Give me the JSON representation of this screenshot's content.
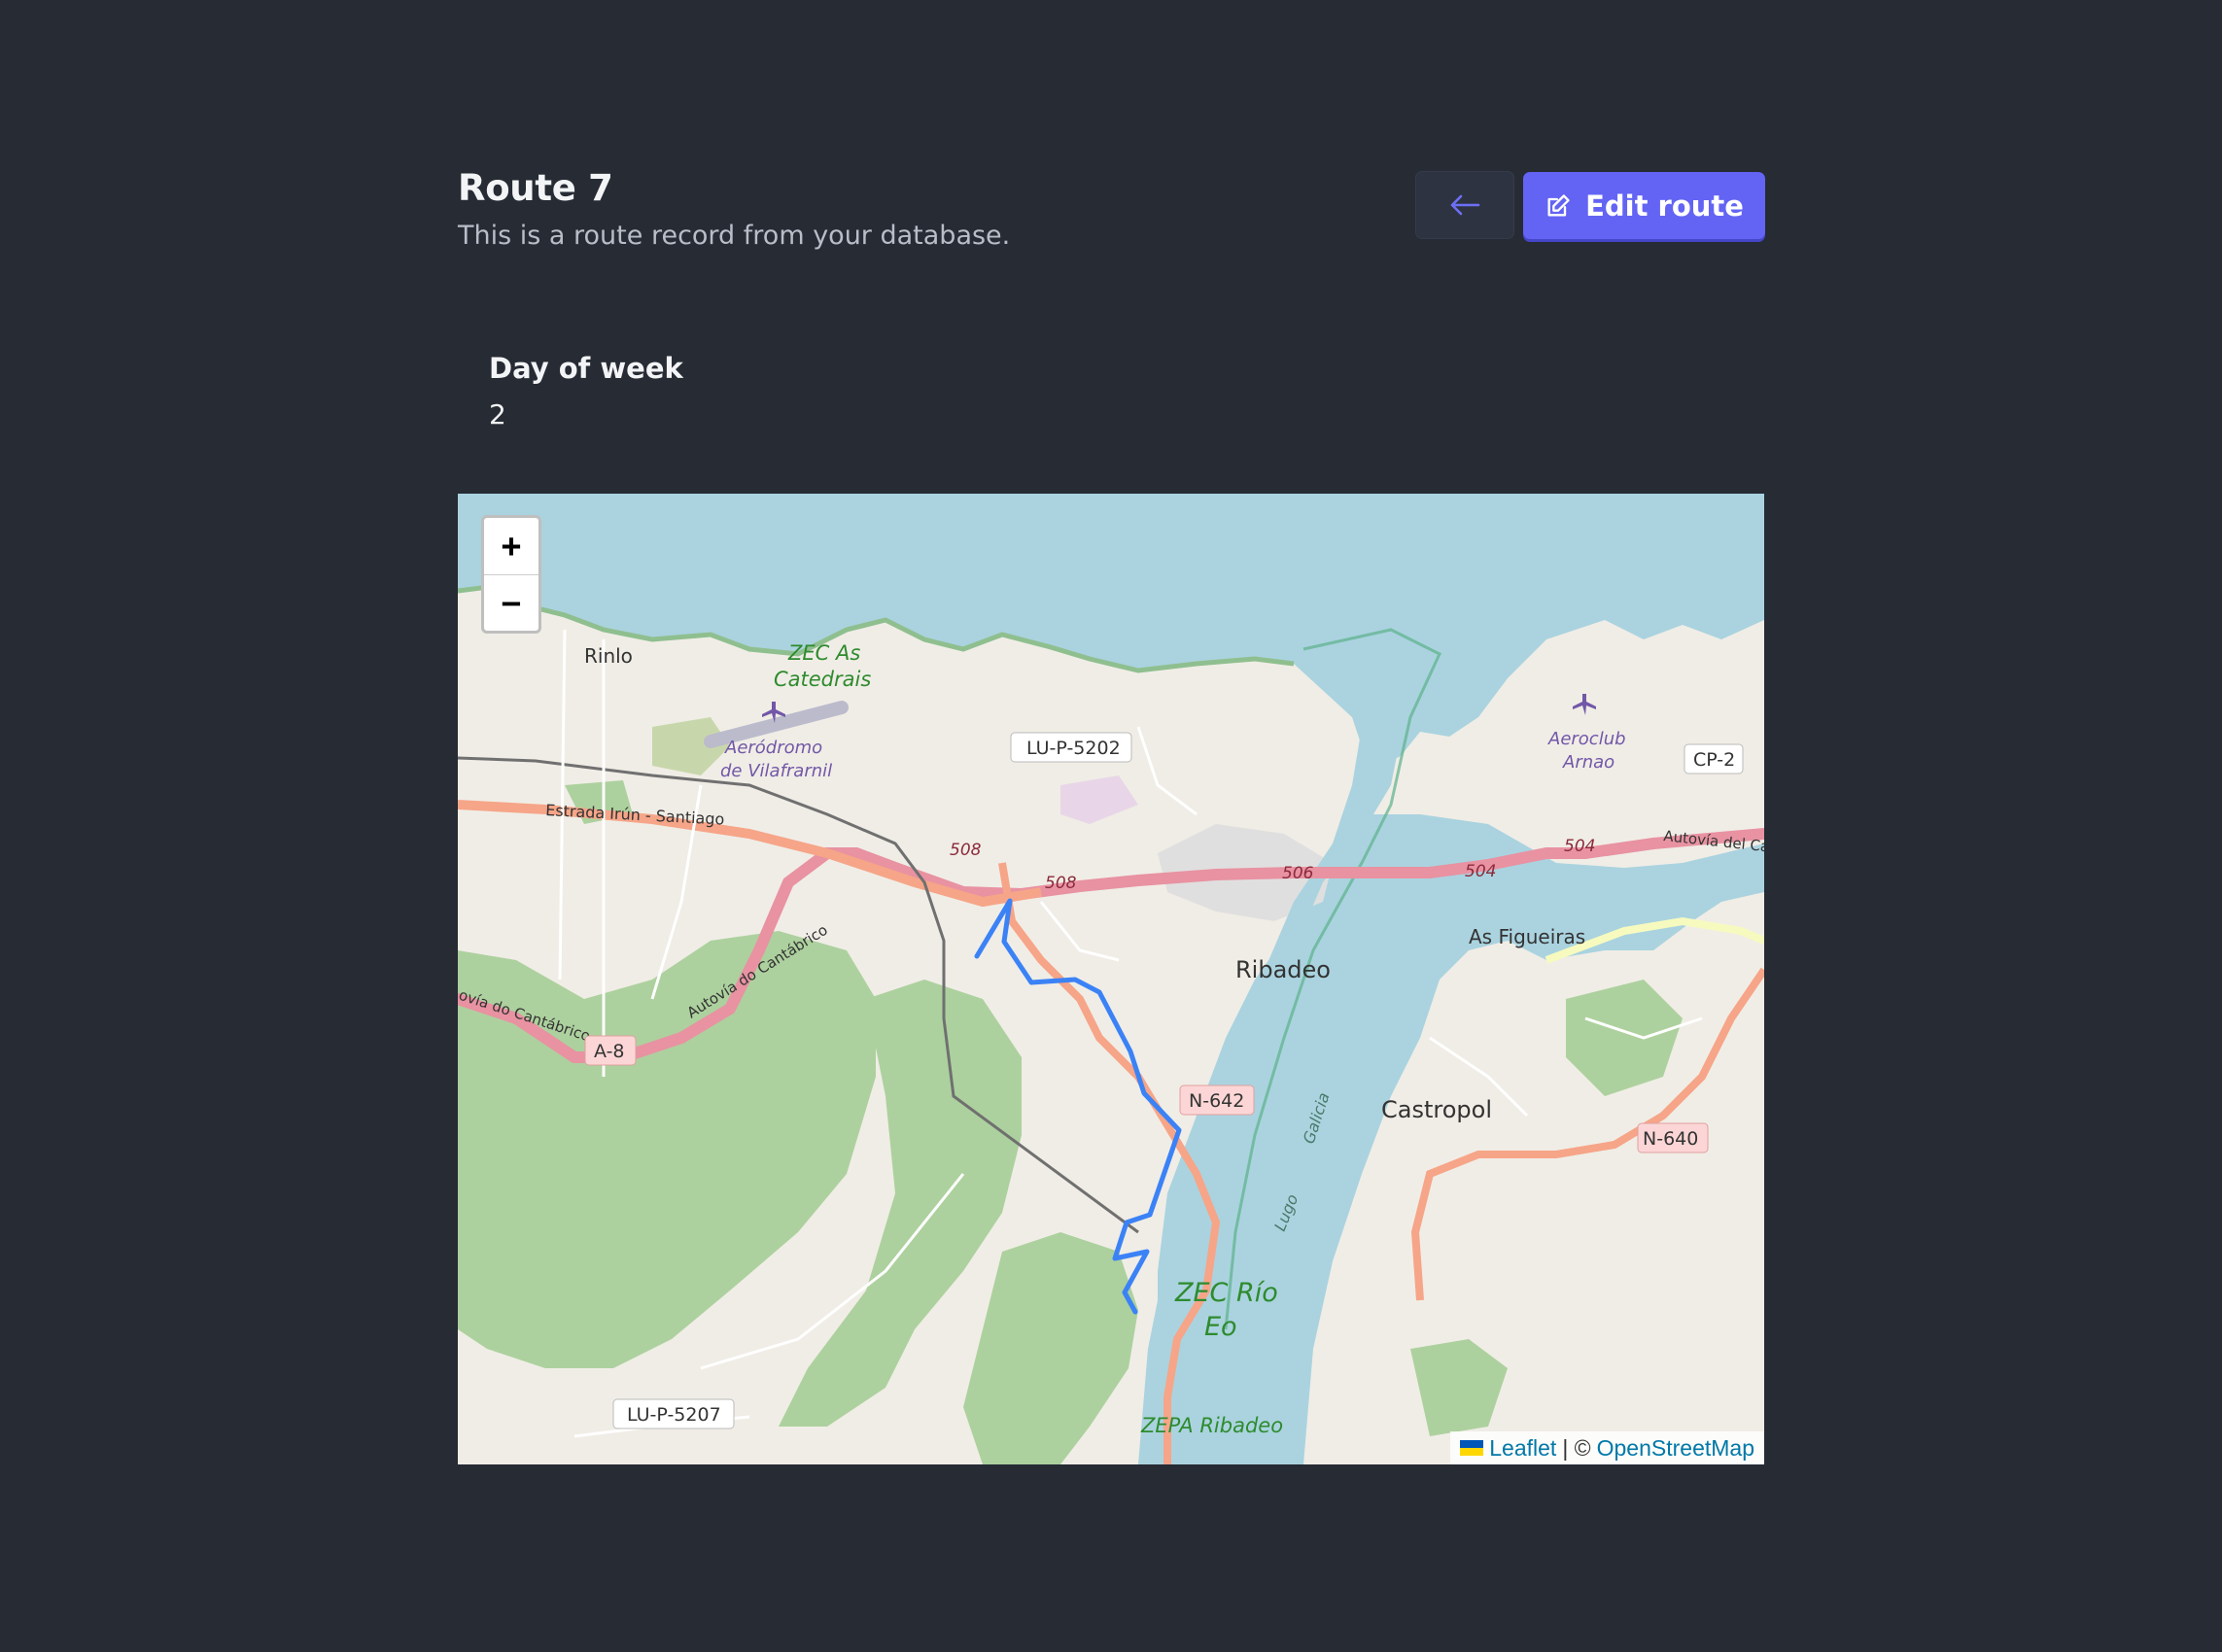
{
  "header": {
    "title": "Route 7",
    "subtitle": "This is a route record from your database.",
    "back_icon": "arrow-left-icon",
    "edit_icon": "pencil-square-icon",
    "edit_label": "Edit route"
  },
  "field": {
    "label": "Day of week",
    "value": "2"
  },
  "map": {
    "zoom_in": "+",
    "zoom_out": "−",
    "attribution": {
      "leaflet": "Leaflet",
      "separator": "| ©",
      "osm": "OpenStreetMap"
    },
    "place_labels": {
      "rinlo": "Rinlo",
      "zec_as_catedrais_1": "ZEC As",
      "zec_as_catedrais_2": "Catedrais",
      "aerodromo_1": "Aeródromo",
      "aerodromo_2": "de Vilafrarnil",
      "aeroclub_1": "Aeroclub",
      "aeroclub_2": "Arnao",
      "ribadeo": "Ribadeo",
      "as_figueiras": "As Figueiras",
      "castropol": "Castropol",
      "zec_rio_eo_1": "ZEC Río",
      "zec_rio_eo_2": "Eo",
      "zepa_ribadeo": "ZEPA Ribadeo",
      "estrada": "Estrada Irún - Santiago",
      "autovia_cantabrico": "Autovía do Cantábrico",
      "autovia_cantabrico_2": "ovía do Cantábrico",
      "autovia_del_cantabrico": "Autovía del Cantabr",
      "lugo": "Lugo",
      "galicia": "Galicia"
    },
    "road_shields": {
      "lu_p_5202": "LU-P-5202",
      "lu_p_5207": "LU-P-5207",
      "cp_2": "CP-2",
      "a_8": "A-8",
      "n_642": "N-642",
      "n_640": "N-640",
      "r508a": "508",
      "r508b": "508",
      "r506": "506",
      "r504a": "504",
      "r504b": "504"
    },
    "route_color": "#3b82f6"
  }
}
